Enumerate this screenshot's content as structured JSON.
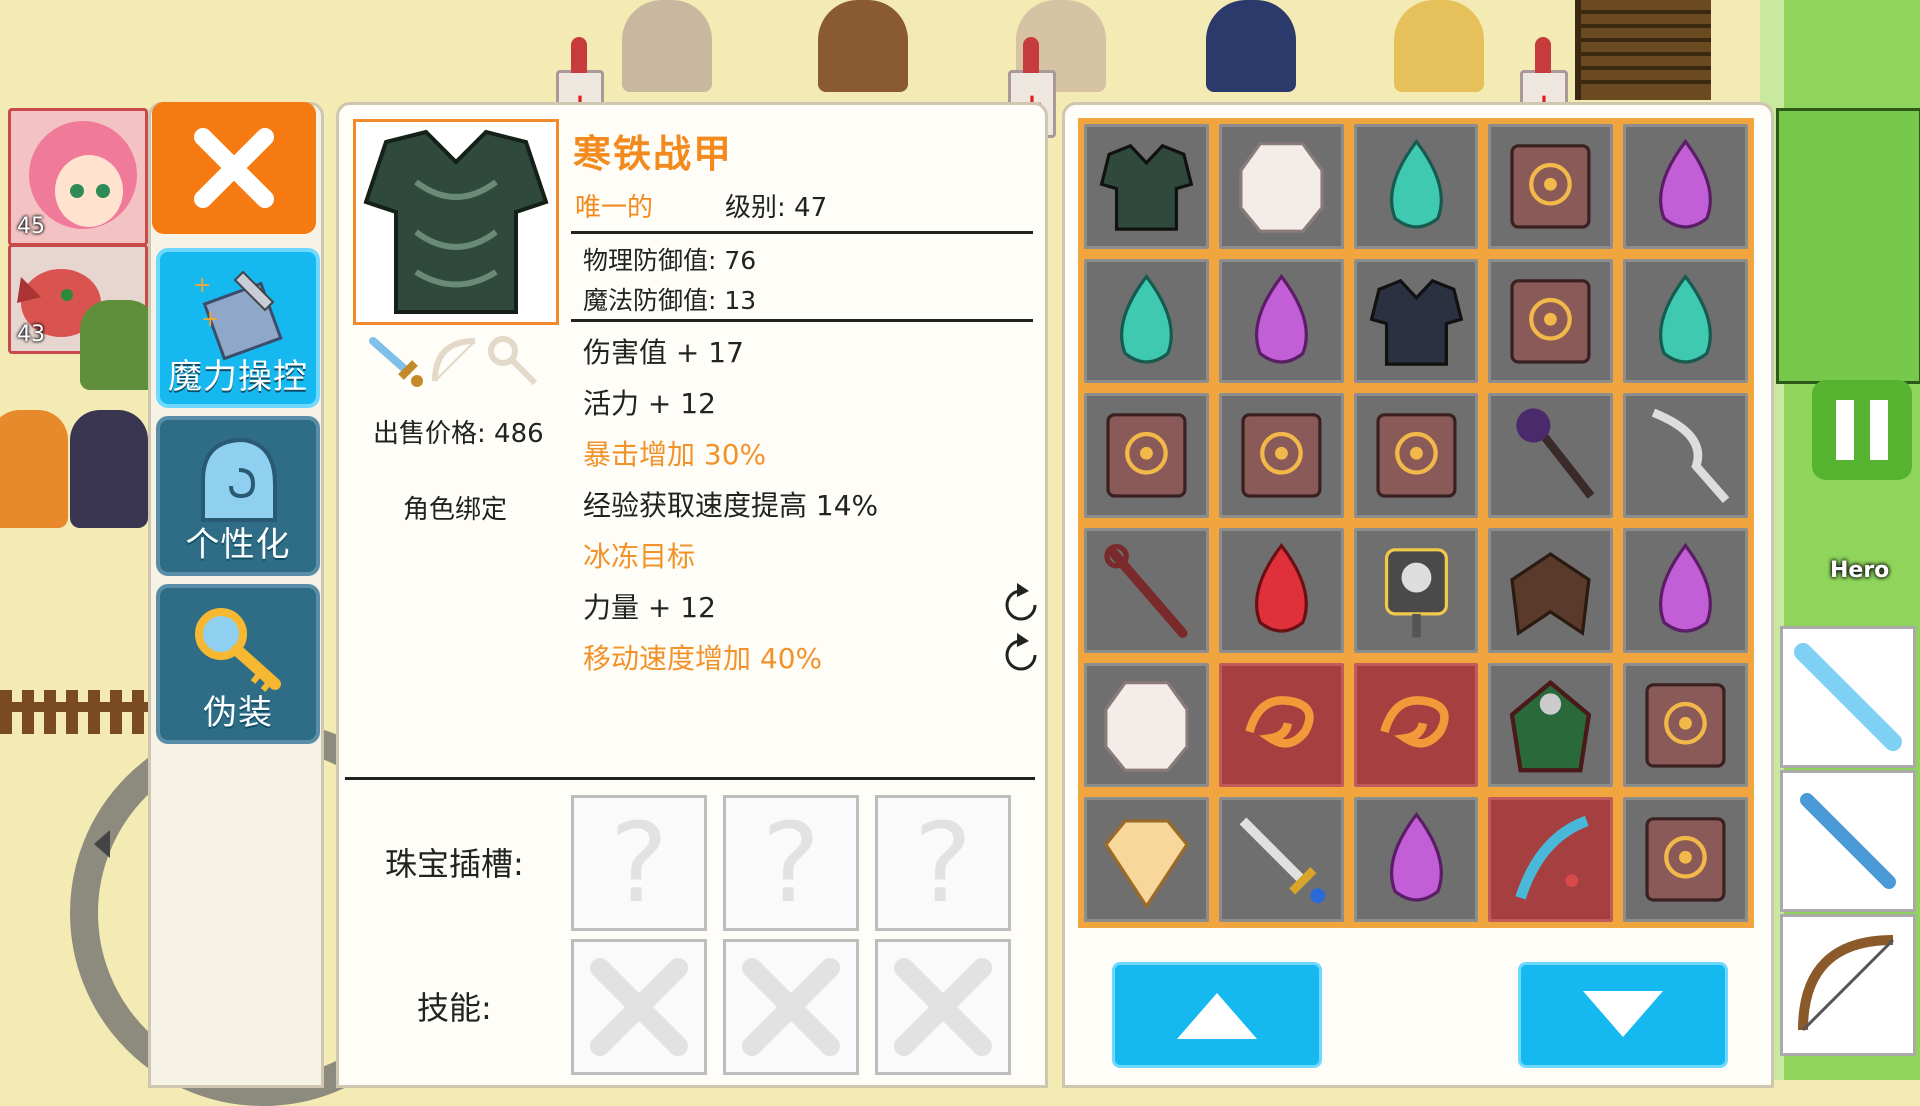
{
  "party": [
    {
      "level": "45"
    },
    {
      "level": "43"
    }
  ],
  "menu": {
    "items": [
      {
        "label": "魔力操控"
      },
      {
        "label": "个性化"
      },
      {
        "label": "伪装"
      }
    ]
  },
  "item": {
    "name": "寒铁战甲",
    "rarity": "唯一的",
    "level": "级别: 47",
    "physical_defense": "物理防御值: 76",
    "magic_defense": "魔法防御值: 13",
    "sell_price": "出售价格: 486",
    "bind": "角色绑定",
    "stats": [
      {
        "text": "伤害值 + 17",
        "special": false
      },
      {
        "text": "活力 + 12",
        "special": false
      },
      {
        "text": "暴击增加 30%",
        "special": true
      },
      {
        "text": "经验获取速度提高 14%",
        "special": false
      },
      {
        "text": "冰冻目标",
        "special": true
      },
      {
        "text": "力量 + 12",
        "special": false
      },
      {
        "text": "移动速度增加 40%",
        "special": true
      }
    ],
    "socket_label": "珠宝插槽:",
    "skill_label": "技能:",
    "socket_placeholder": "?"
  },
  "inventory": {
    "cells": [
      "dark-armor",
      "white-gem",
      "teal-crystal",
      "spell-book",
      "purple-crystal",
      "teal-crystal",
      "purple-crystal",
      "black-armor",
      "spell-book",
      "teal-crystal",
      "spell-book",
      "spell-book",
      "spell-book",
      "dark-axe",
      "bone-scythe",
      "wooden-staff",
      "red-crystal",
      "skull-shield",
      "bone-wings",
      "purple-crystal",
      "white-gem",
      "fire-rune",
      "fire-rune",
      "green-cloak",
      "spell-book",
      "amber-gem",
      "golden-sword",
      "purple-crystal",
      "feather-charm",
      "spell-book"
    ],
    "red_cells": [
      21,
      22,
      28
    ]
  },
  "hud": {
    "hero_label": "Hero"
  },
  "colors": {
    "accent_orange": "#f28a1e",
    "menu_blue": "#16b9ef",
    "menu_dark": "#2f6d87",
    "grid_orange": "#f0a53e",
    "pause_green": "#55b32f"
  }
}
